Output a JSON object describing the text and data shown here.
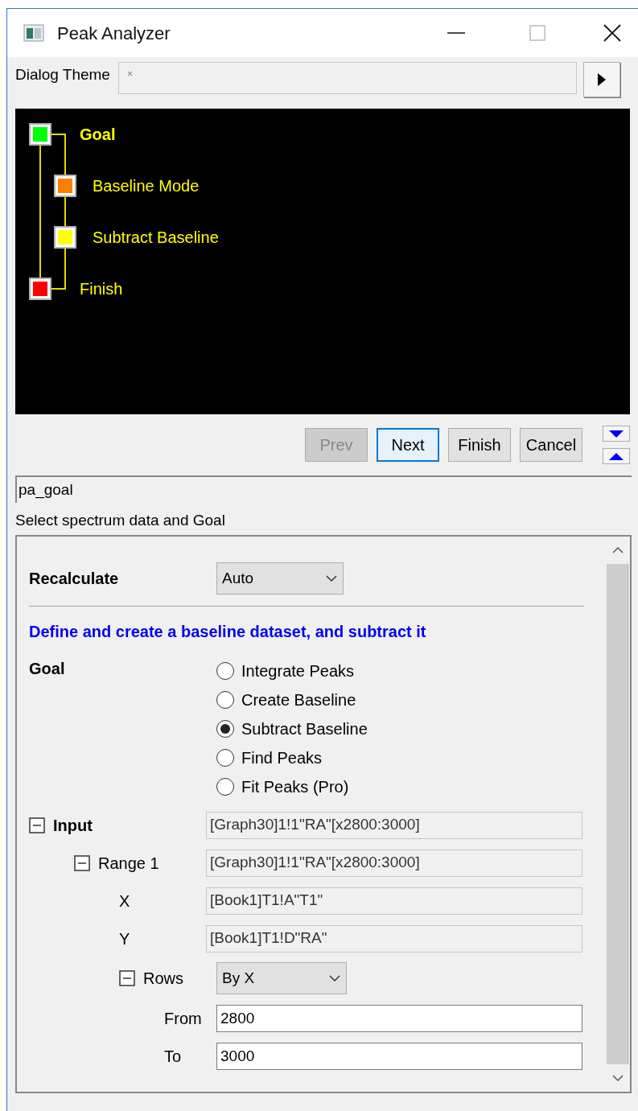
{
  "window": {
    "title": "Peak Analyzer"
  },
  "dialog_theme": {
    "label": "Dialog Theme",
    "placeholder": "×"
  },
  "flowchart": {
    "steps": [
      {
        "label": "Goal",
        "selected": true,
        "color": "#00ff00",
        "children": [
          {
            "label": "Baseline Mode",
            "selected": false,
            "color": "#ff8000"
          },
          {
            "label": "Subtract Baseline",
            "selected": false,
            "color": "#ffff00"
          }
        ]
      },
      {
        "label": "Finish",
        "selected": false,
        "color": "#ff0000"
      }
    ]
  },
  "buttons": [
    {
      "label": "Prev",
      "disabled": true,
      "focused": false
    },
    {
      "label": "Next",
      "disabled": false,
      "focused": true
    },
    {
      "label": "Finish",
      "disabled": false,
      "focused": false
    },
    {
      "label": "Cancel",
      "disabled": false,
      "focused": false
    }
  ],
  "page_name": "pa_goal",
  "description": "Select spectrum data and Goal",
  "settings": {
    "recalculate": {
      "label": "Recalculate",
      "value": "Auto"
    },
    "heading": "Define and create a baseline dataset, and subtract it",
    "goal": {
      "label": "Goal",
      "options": [
        {
          "label": "Integrate Peaks",
          "selected": false
        },
        {
          "label": "Create Baseline",
          "selected": false
        },
        {
          "label": "Subtract Baseline",
          "selected": true
        },
        {
          "label": "Find Peaks",
          "selected": false
        },
        {
          "label": "Fit Peaks (Pro)",
          "selected": false
        }
      ]
    },
    "tree": [
      {
        "label": "Input",
        "kind": "readonly",
        "value": "[Graph30]1!1\"RA\"[x2800:3000]",
        "expanded": true,
        "children": [
          {
            "label": "Range 1",
            "kind": "readonly",
            "value": "[Graph30]1!1\"RA\"[x2800:3000]",
            "expanded": true,
            "children": [
              {
                "label": "X",
                "kind": "readonly",
                "value": "[Book1]T1!A\"T1\""
              },
              {
                "label": "Y",
                "kind": "readonly",
                "value": "[Book1]T1!D\"RA\""
              },
              {
                "label": "Rows",
                "kind": "dropdown",
                "value": "By X",
                "expanded": true,
                "children": [
                  {
                    "label": "From",
                    "kind": "input",
                    "value": "2800"
                  },
                  {
                    "label": "To",
                    "kind": "input",
                    "value": "3000"
                  }
                ]
              }
            ]
          }
        ]
      }
    ]
  }
}
